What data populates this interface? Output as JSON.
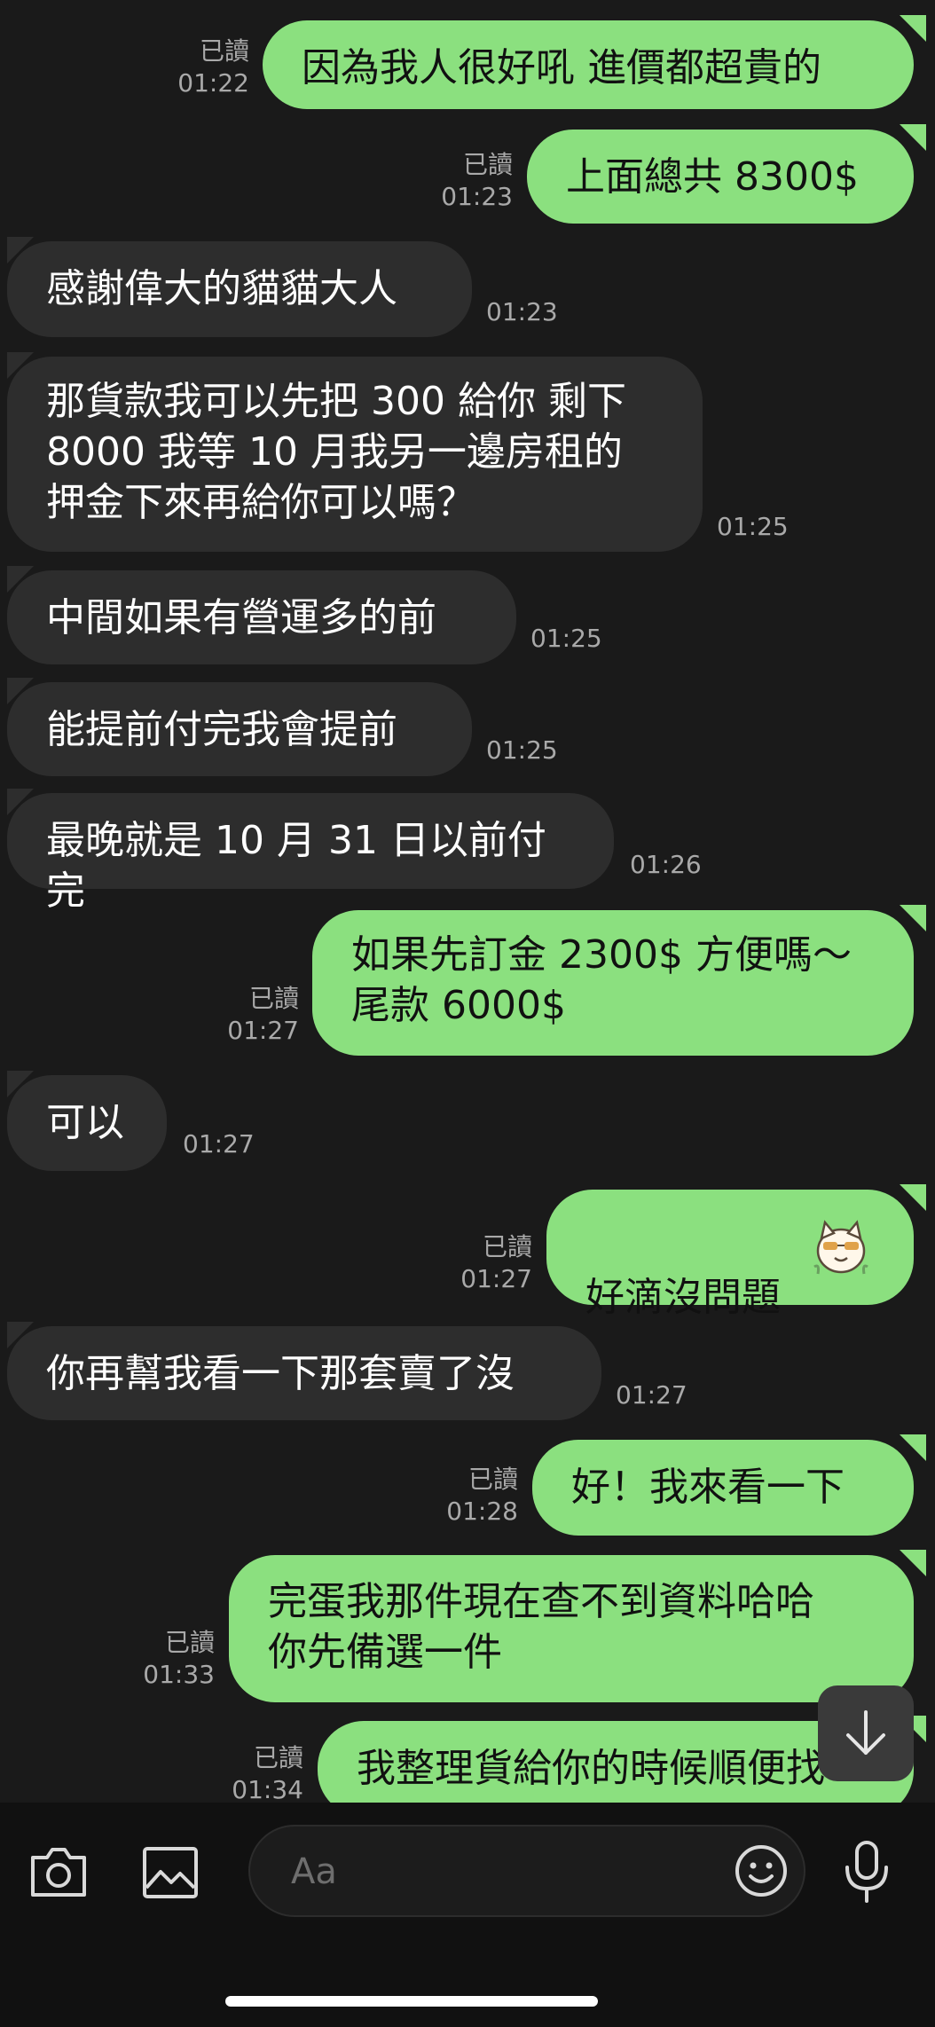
{
  "messages": [
    {
      "dir": "out",
      "text": "因為我人很好吼 進價都超貴的",
      "read": "已讀",
      "time": "01:22"
    },
    {
      "dir": "out",
      "text": "上面總共 8300$",
      "read": "已讀",
      "time": "01:23"
    },
    {
      "dir": "in",
      "text": "感謝偉大的貓貓大人",
      "time": "01:23"
    },
    {
      "dir": "in",
      "text": "那貨款我可以先把 300 給你 剩下\n8000 我等 10 月我另一邊房租的\n押金下來再給你可以嗎？",
      "time": "01:25"
    },
    {
      "dir": "in",
      "text": "中間如果有營運多的前",
      "time": "01:25"
    },
    {
      "dir": "in",
      "text": "能提前付完我會提前",
      "time": "01:25"
    },
    {
      "dir": "in",
      "text": "最晚就是 10 月 31 日以前付完",
      "time": "01:26"
    },
    {
      "dir": "out",
      "text": "如果先訂金 2300$ 方便嗎～\n尾款 6000$",
      "read": "已讀",
      "time": "01:27"
    },
    {
      "dir": "in",
      "text": "可以",
      "time": "01:27"
    },
    {
      "dir": "out",
      "text": "好滴沒問題",
      "read": "已讀",
      "time": "01:27",
      "sticker": "cat-sticker"
    },
    {
      "dir": "in",
      "text": "你再幫我看一下那套賣了沒",
      "time": "01:27"
    },
    {
      "dir": "out",
      "text": "好！我來看一下",
      "read": "已讀",
      "time": "01:28"
    },
    {
      "dir": "out",
      "text": "完蛋我那件現在查不到資料哈哈\n你先備選一件",
      "read": "已讀",
      "time": "01:33"
    },
    {
      "dir": "out",
      "text": "我整理貨給你的時候順便找",
      "read": "已讀",
      "time": "01:34"
    }
  ],
  "input": {
    "placeholder": "Aa"
  },
  "icons": {
    "camera": "camera-icon",
    "gallery": "image-icon",
    "emoji": "emoji-icon",
    "mic": "microphone-icon",
    "scroll_down": "arrow-down-icon"
  },
  "colors": {
    "background": "#1a1a1a",
    "incoming_bubble": "#2d2d2d",
    "outgoing_bubble": "#8be07f",
    "meta_text": "#a9a9a9"
  }
}
